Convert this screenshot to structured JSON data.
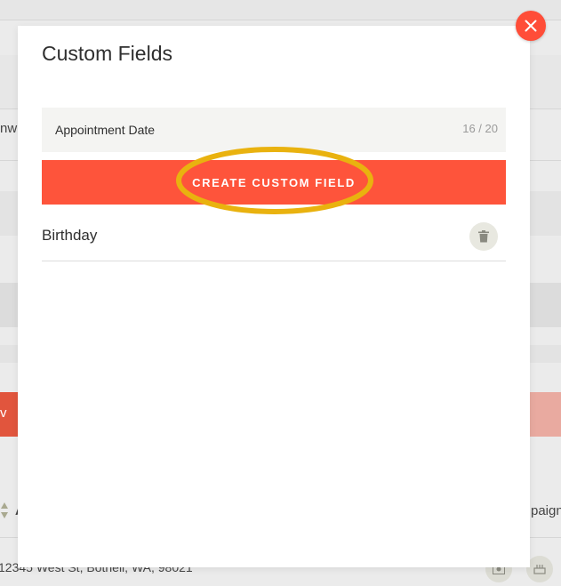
{
  "background": {
    "left_cutoff_label": "nw",
    "left_cutoff_red_label": "v",
    "column_cutoff_a": "A",
    "column_cutoff_campaign": "paign",
    "address_text": "12345 West St, Bothell, WA, 98021",
    "icons": [
      "photo-icon",
      "cake-icon"
    ]
  },
  "modal": {
    "title": "Custom Fields",
    "input": {
      "value": "Appointment Date",
      "placeholder": "",
      "counter": "16 / 20"
    },
    "create_button_label": "CREATE CUSTOM FIELD",
    "custom_fields": [
      {
        "name": "Birthday"
      }
    ],
    "icons": {
      "close": "close-icon",
      "delete": "trash-icon"
    }
  },
  "colors": {
    "accent": "#fe543b",
    "close": "#ff4d38",
    "highlight": "#e9b20f"
  }
}
